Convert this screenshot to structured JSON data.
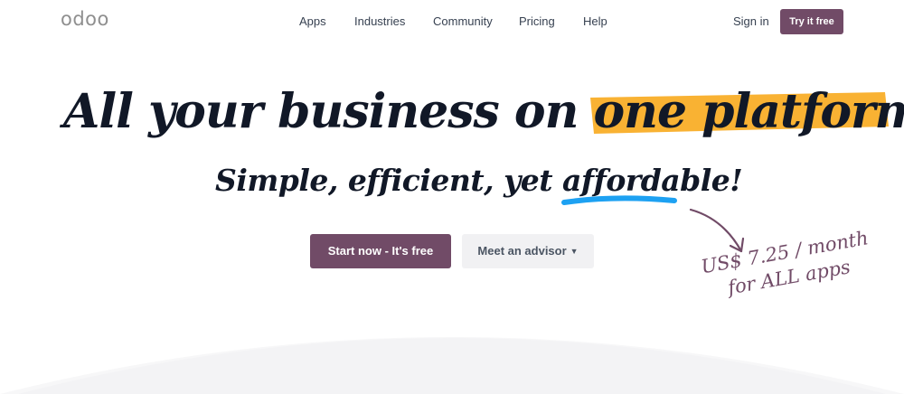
{
  "header": {
    "logo": "odoo",
    "nav": [
      "Apps",
      "Industries",
      "Community",
      "Pricing",
      "Help"
    ],
    "sign_in": "Sign in",
    "try_free": "Try it free"
  },
  "hero": {
    "title_start": "All your business on ",
    "title_highlight": "one platform.",
    "subtitle_start": "Simple, efficient, yet ",
    "subtitle_underlined": "affordable",
    "subtitle_end": "!"
  },
  "buttons": {
    "start": "Start now - It's free",
    "advisor": "Meet an advisor"
  },
  "price_note": {
    "line1": "US$ 7.25 / month",
    "line2": "for ALL apps"
  },
  "colors": {
    "brand": "#714B67",
    "highlight": "#F9B233",
    "underline": "#1DA1F2"
  },
  "icons": {
    "advisor_caret": "caret-down-icon",
    "price_arrow": "curved-arrow-icon"
  }
}
